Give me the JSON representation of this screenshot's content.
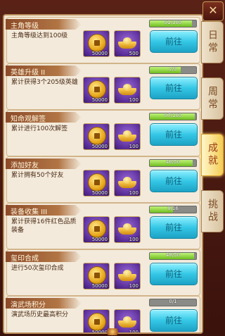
{
  "close_icon": "close-x-icon",
  "tabs": [
    {
      "label": "日常",
      "active": false
    },
    {
      "label": "周常",
      "active": false
    },
    {
      "label": "成就",
      "active": true
    },
    {
      "label": "挑战",
      "active": false
    }
  ],
  "quests": [
    {
      "title": "主角等级",
      "desc": "主角等级达到100级",
      "progress": "91/100",
      "progress_value": 0.91,
      "rewards": [
        {
          "icon": "copper-coin-icon",
          "count": "50000"
        },
        {
          "icon": "gold-ingot-icon",
          "count": "500"
        }
      ],
      "button": "前往"
    },
    {
      "title": "英雄升级 II",
      "desc": "累计获得3个205级英雄",
      "progress": "2/3",
      "progress_value": 0.67,
      "rewards": [
        {
          "icon": "copper-coin-icon",
          "count": "50000"
        },
        {
          "icon": "gold-ingot-icon",
          "count": "100"
        }
      ],
      "button": "前往"
    },
    {
      "title": "知命观解签",
      "desc": "累计进行100次解签",
      "progress": "97/100",
      "progress_value": 0.97,
      "rewards": [
        {
          "icon": "copper-coin-icon",
          "count": "50000"
        },
        {
          "icon": "gold-ingot-icon",
          "count": "100"
        }
      ],
      "button": "前往"
    },
    {
      "title": "添加好友",
      "desc": "累计拥有50个好友",
      "progress": "46/50",
      "progress_value": 0.92,
      "rewards": [
        {
          "icon": "copper-coin-icon",
          "count": "50000"
        },
        {
          "icon": "gold-ingot-icon",
          "count": "100"
        }
      ],
      "button": "前往"
    },
    {
      "title": "装备收集 III",
      "desc": "累计获得16件红色品质装备",
      "progress": "8/16",
      "progress_value": 0.5,
      "rewards": [
        {
          "icon": "copper-coin-icon",
          "count": "50000"
        },
        {
          "icon": "gold-ingot-icon",
          "count": "100"
        }
      ],
      "button": "前往"
    },
    {
      "title": "玺印合成",
      "desc": "进行50次玺印合成",
      "progress": "48/50",
      "progress_value": 0.96,
      "rewards": [
        {
          "icon": "copper-coin-icon",
          "count": "50000"
        },
        {
          "icon": "gold-ingot-icon",
          "count": "100"
        }
      ],
      "button": "前往"
    },
    {
      "title": "演武场积分",
      "desc": "演武场历史最高积分",
      "progress": "0/1",
      "progress_value": 0.0,
      "rewards": [
        {
          "icon": "copper-coin-icon",
          "count": "50000"
        },
        {
          "icon": "gold-ingot-icon",
          "count": "100"
        }
      ],
      "button": "前往"
    }
  ]
}
